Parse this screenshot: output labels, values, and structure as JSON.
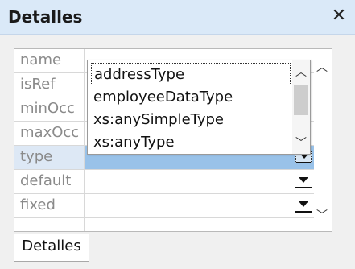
{
  "window": {
    "title": "Detalles",
    "close_symbol": "✕"
  },
  "properties": [
    {
      "name": "name",
      "value": "addressType",
      "has_dropdown": false,
      "selected": false
    },
    {
      "name": "isRef",
      "value": "",
      "has_dropdown": false,
      "selected": false
    },
    {
      "name": "minOcc",
      "value": "",
      "has_dropdown": false,
      "selected": false
    },
    {
      "name": "maxOcc",
      "value": "",
      "has_dropdown": false,
      "selected": false
    },
    {
      "name": "type",
      "value": "",
      "has_dropdown": true,
      "selected": true
    },
    {
      "name": "default",
      "value": "",
      "has_dropdown": true,
      "selected": false
    },
    {
      "name": "fixed",
      "value": "",
      "has_dropdown": true,
      "selected": false
    }
  ],
  "dropdown_list": {
    "items": [
      "addressType",
      "employeeDataType",
      "xs:anySimpleType",
      "xs:anyType"
    ],
    "focused_index": 0
  },
  "tabs": [
    {
      "label": "Detalles",
      "active": true
    }
  ],
  "icons": {
    "scroll_up": "chevron-up-icon",
    "scroll_down": "chevron-down-icon",
    "dropdown": "dropdown-arrow-icon",
    "close": "close-icon"
  },
  "colors": {
    "titlebar": "#dae9f8",
    "selected_row_value": "#99c2e9",
    "selected_row_name": "#dde8f5",
    "label_text": "#8a8a8a"
  }
}
